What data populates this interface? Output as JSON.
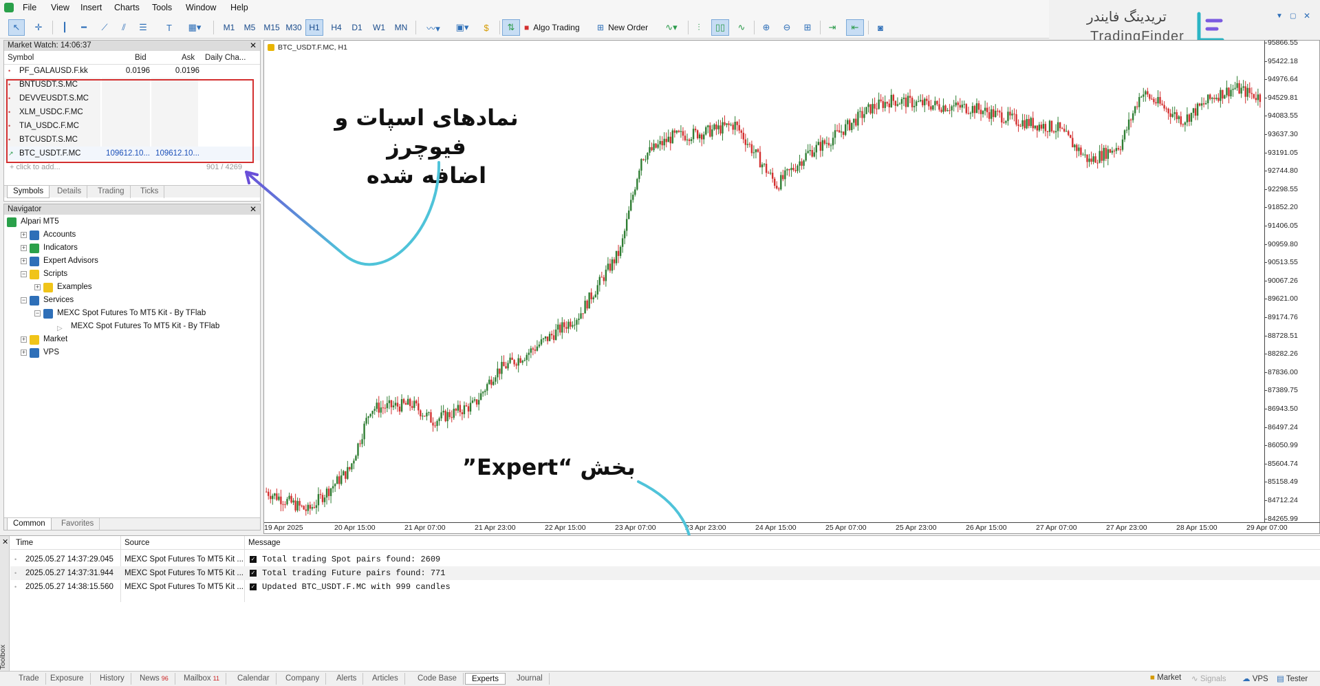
{
  "menu": [
    "File",
    "View",
    "Insert",
    "Charts",
    "Tools",
    "Window",
    "Help"
  ],
  "timeframes": [
    "M1",
    "M5",
    "M15",
    "M30",
    "H1",
    "H4",
    "D1",
    "W1",
    "MN"
  ],
  "active_timeframe": "H1",
  "toolbar": {
    "algo_trading": "Algo Trading",
    "new_order": "New Order"
  },
  "brand": {
    "fa": "تریدینگ فایندر",
    "en": "TradingFinder"
  },
  "market_watch": {
    "title": "Market Watch: 14:06:37",
    "columns": [
      "Symbol",
      "Bid",
      "Ask",
      "Daily Cha..."
    ],
    "rows": [
      {
        "symbol": "PF_GALAUSD.F.kk",
        "bid": "0.0196",
        "ask": "0.0196"
      },
      {
        "symbol": "BNTUSDT.S.MC",
        "bid": "",
        "ask": ""
      },
      {
        "symbol": "DEVVEUSDT.S.MC",
        "bid": "",
        "ask": ""
      },
      {
        "symbol": "XLM_USDC.F.MC",
        "bid": "",
        "ask": ""
      },
      {
        "symbol": "TIA_USDC.F.MC",
        "bid": "",
        "ask": ""
      },
      {
        "symbol": "BTCUSDT.S.MC",
        "bid": "",
        "ask": ""
      },
      {
        "symbol": "BTC_USDT.F.MC",
        "bid": "109612.10...",
        "ask": "109612.10..."
      }
    ],
    "add_placeholder": "click to add...",
    "count": "901 / 4269",
    "tabs": [
      "Symbols",
      "Details",
      "Trading",
      "Ticks"
    ],
    "highlight_color": "#d32f2f"
  },
  "navigator": {
    "title": "Navigator",
    "items": [
      {
        "label": "Alpari MT5",
        "level": 0,
        "icon": "broker-icon"
      },
      {
        "label": "Accounts",
        "level": 1,
        "icon": "accounts-icon"
      },
      {
        "label": "Indicators",
        "level": 1,
        "icon": "indicators-icon"
      },
      {
        "label": "Expert Advisors",
        "level": 1,
        "icon": "expert-icon"
      },
      {
        "label": "Scripts",
        "level": 1,
        "icon": "folder-icon"
      },
      {
        "label": "Examples",
        "level": 2,
        "icon": "folder-icon"
      },
      {
        "label": "Services",
        "level": 1,
        "icon": "services-icon"
      },
      {
        "label": "MEXC Spot Futures To MT5 Kit - By TFlab",
        "level": 2,
        "icon": "service-gear-icon"
      },
      {
        "label": "MEXC Spot Futures To MT5 Kit - By TFlab",
        "level": 3,
        "icon": "play-icon"
      },
      {
        "label": "Market",
        "level": 1,
        "icon": "market-icon"
      },
      {
        "label": "VPS",
        "level": 1,
        "icon": "vps-icon"
      }
    ],
    "tabs": [
      "Common",
      "Favorites"
    ]
  },
  "chart": {
    "title": "BTC_USDT.F.MC, H1",
    "y_ticks": [
      "95866.55",
      "95422.18",
      "94976.64",
      "94529.81",
      "94083.55",
      "93637.30",
      "93191.05",
      "92744.80",
      "92298.55",
      "91852.20",
      "91406.05",
      "90959.80",
      "90513.55",
      "90067.26",
      "89621.00",
      "89174.76",
      "88728.51",
      "88282.26",
      "87836.00",
      "87389.75",
      "86943.50",
      "86497.24",
      "86050.99",
      "85604.74",
      "85158.49",
      "84712.24",
      "84265.99"
    ],
    "x_ticks": [
      "19 Apr 2025",
      "20 Apr 15:00",
      "21 Apr 07:00",
      "21 Apr 23:00",
      "22 Apr 15:00",
      "23 Apr 07:00",
      "23 Apr 23:00",
      "24 Apr 15:00",
      "25 Apr 07:00",
      "25 Apr 23:00",
      "26 Apr 15:00",
      "27 Apr 07:00",
      "27 Apr 23:00",
      "28 Apr 15:00",
      "29 Apr 07:00"
    ],
    "up_color": "#2e7d32",
    "down_color": "#d32f2f"
  },
  "annotations": {
    "symbols_added": [
      "نمادهای اسپات و فیوچرز",
      "اضافه شده"
    ],
    "expert_section": "بخش “Expert”",
    "arrow_color": "#4fc3d9"
  },
  "toolbox": {
    "columns": [
      "Time",
      "Source",
      "Message"
    ],
    "rows": [
      {
        "time": "2025.05.27 14:37:29.045",
        "source": "MEXC Spot Futures To MT5 Kit ...",
        "message": "Total trading Spot pairs found: 2609"
      },
      {
        "time": "2025.05.27 14:37:31.944",
        "source": "MEXC Spot Futures To MT5 Kit ...",
        "message": "Total trading Future pairs found: 771"
      },
      {
        "time": "2025.05.27 14:38:15.560",
        "source": "MEXC Spot Futures To MT5 Kit ...",
        "message": "Updated BTC_USDT.F.MC with 999 candles"
      }
    ],
    "side_label": "Toolbox"
  },
  "bottom_tabs": [
    {
      "label": "Trade"
    },
    {
      "label": "Exposure"
    },
    {
      "label": "History"
    },
    {
      "label": "News",
      "badge": "96"
    },
    {
      "label": "Mailbox",
      "badge": "11"
    },
    {
      "label": "Calendar"
    },
    {
      "label": "Company"
    },
    {
      "label": "Alerts"
    },
    {
      "label": "Articles"
    },
    {
      "label": "Code Base"
    },
    {
      "label": "Experts",
      "active": true
    },
    {
      "label": "Journal"
    }
  ],
  "status": {
    "market": "Market",
    "signals": "Signals",
    "vps": "VPS",
    "tester": "Tester"
  }
}
